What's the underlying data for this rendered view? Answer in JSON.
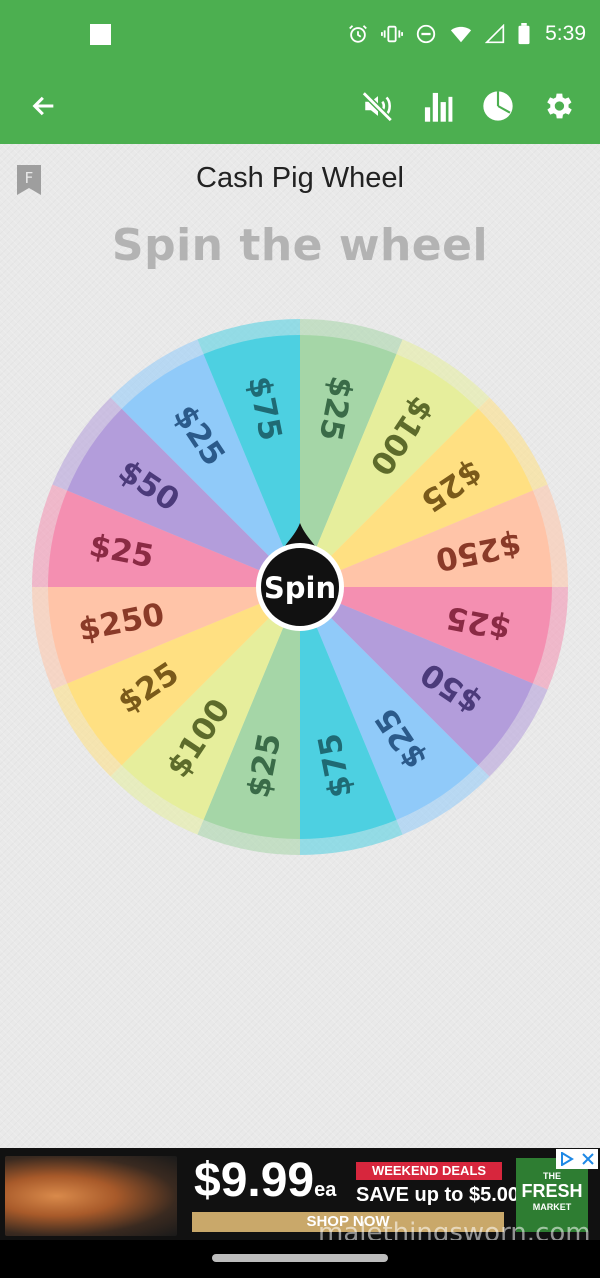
{
  "status_bar": {
    "time": "5:39",
    "icons": [
      "stop-square-icon",
      "alarm-icon",
      "vibrate-icon",
      "do-not-disturb-icon",
      "wifi-icon",
      "signal-icon",
      "battery-icon"
    ]
  },
  "app_bar": {
    "icons": [
      "back-arrow-icon",
      "sound-off-icon",
      "bar-chart-icon",
      "pie-chart-icon",
      "settings-gear-icon"
    ],
    "background": "#4caf50"
  },
  "main": {
    "bookmark_letter": "F",
    "title": "Cash Pig Wheel",
    "subtitle": "Spin the wheel",
    "spin_label": "Spin"
  },
  "wheel": {
    "segments": [
      {
        "label": "$25",
        "color": "#a5d6a7",
        "text_color": "#3a6b48"
      },
      {
        "label": "$100",
        "color": "#e6ee9c",
        "text_color": "#5d6b2b"
      },
      {
        "label": "$25",
        "color": "#ffe082",
        "text_color": "#7a5a1a"
      },
      {
        "label": "$250",
        "color": "#ffc4a8",
        "text_color": "#8a3a28"
      },
      {
        "label": "$25",
        "color": "#f48fb1",
        "text_color": "#8a2a44"
      },
      {
        "label": "$50",
        "color": "#b39ddb",
        "text_color": "#4b3a7a"
      },
      {
        "label": "$25",
        "color": "#90caf9",
        "text_color": "#2b5a8a"
      },
      {
        "label": "$75",
        "color": "#4dd0e1",
        "text_color": "#1f6a74"
      },
      {
        "label": "$25",
        "color": "#a5d6a7",
        "text_color": "#3a6b48"
      },
      {
        "label": "$100",
        "color": "#e6ee9c",
        "text_color": "#5d6b2b"
      },
      {
        "label": "$25",
        "color": "#ffe082",
        "text_color": "#7a5a1a"
      },
      {
        "label": "$250",
        "color": "#ffc4a8",
        "text_color": "#8a3a28"
      },
      {
        "label": "$25",
        "color": "#f48fb1",
        "text_color": "#8a2a44"
      },
      {
        "label": "$50",
        "color": "#b39ddb",
        "text_color": "#4b3a7a"
      },
      {
        "label": "$25",
        "color": "#90caf9",
        "text_color": "#2b5a8a"
      },
      {
        "label": "$75",
        "color": "#4dd0e1",
        "text_color": "#1f6a74"
      }
    ]
  },
  "ad": {
    "price": "$9.99",
    "price_unit": "ea",
    "deals_label": "WEEKEND DEALS",
    "save_text": "SAVE up to $5.00..",
    "cta": "SHOP NOW",
    "brand_line1": "THE",
    "brand_line2": "FRESH",
    "brand_line3": "MARKET",
    "watermark": "malethingsworn.com"
  }
}
